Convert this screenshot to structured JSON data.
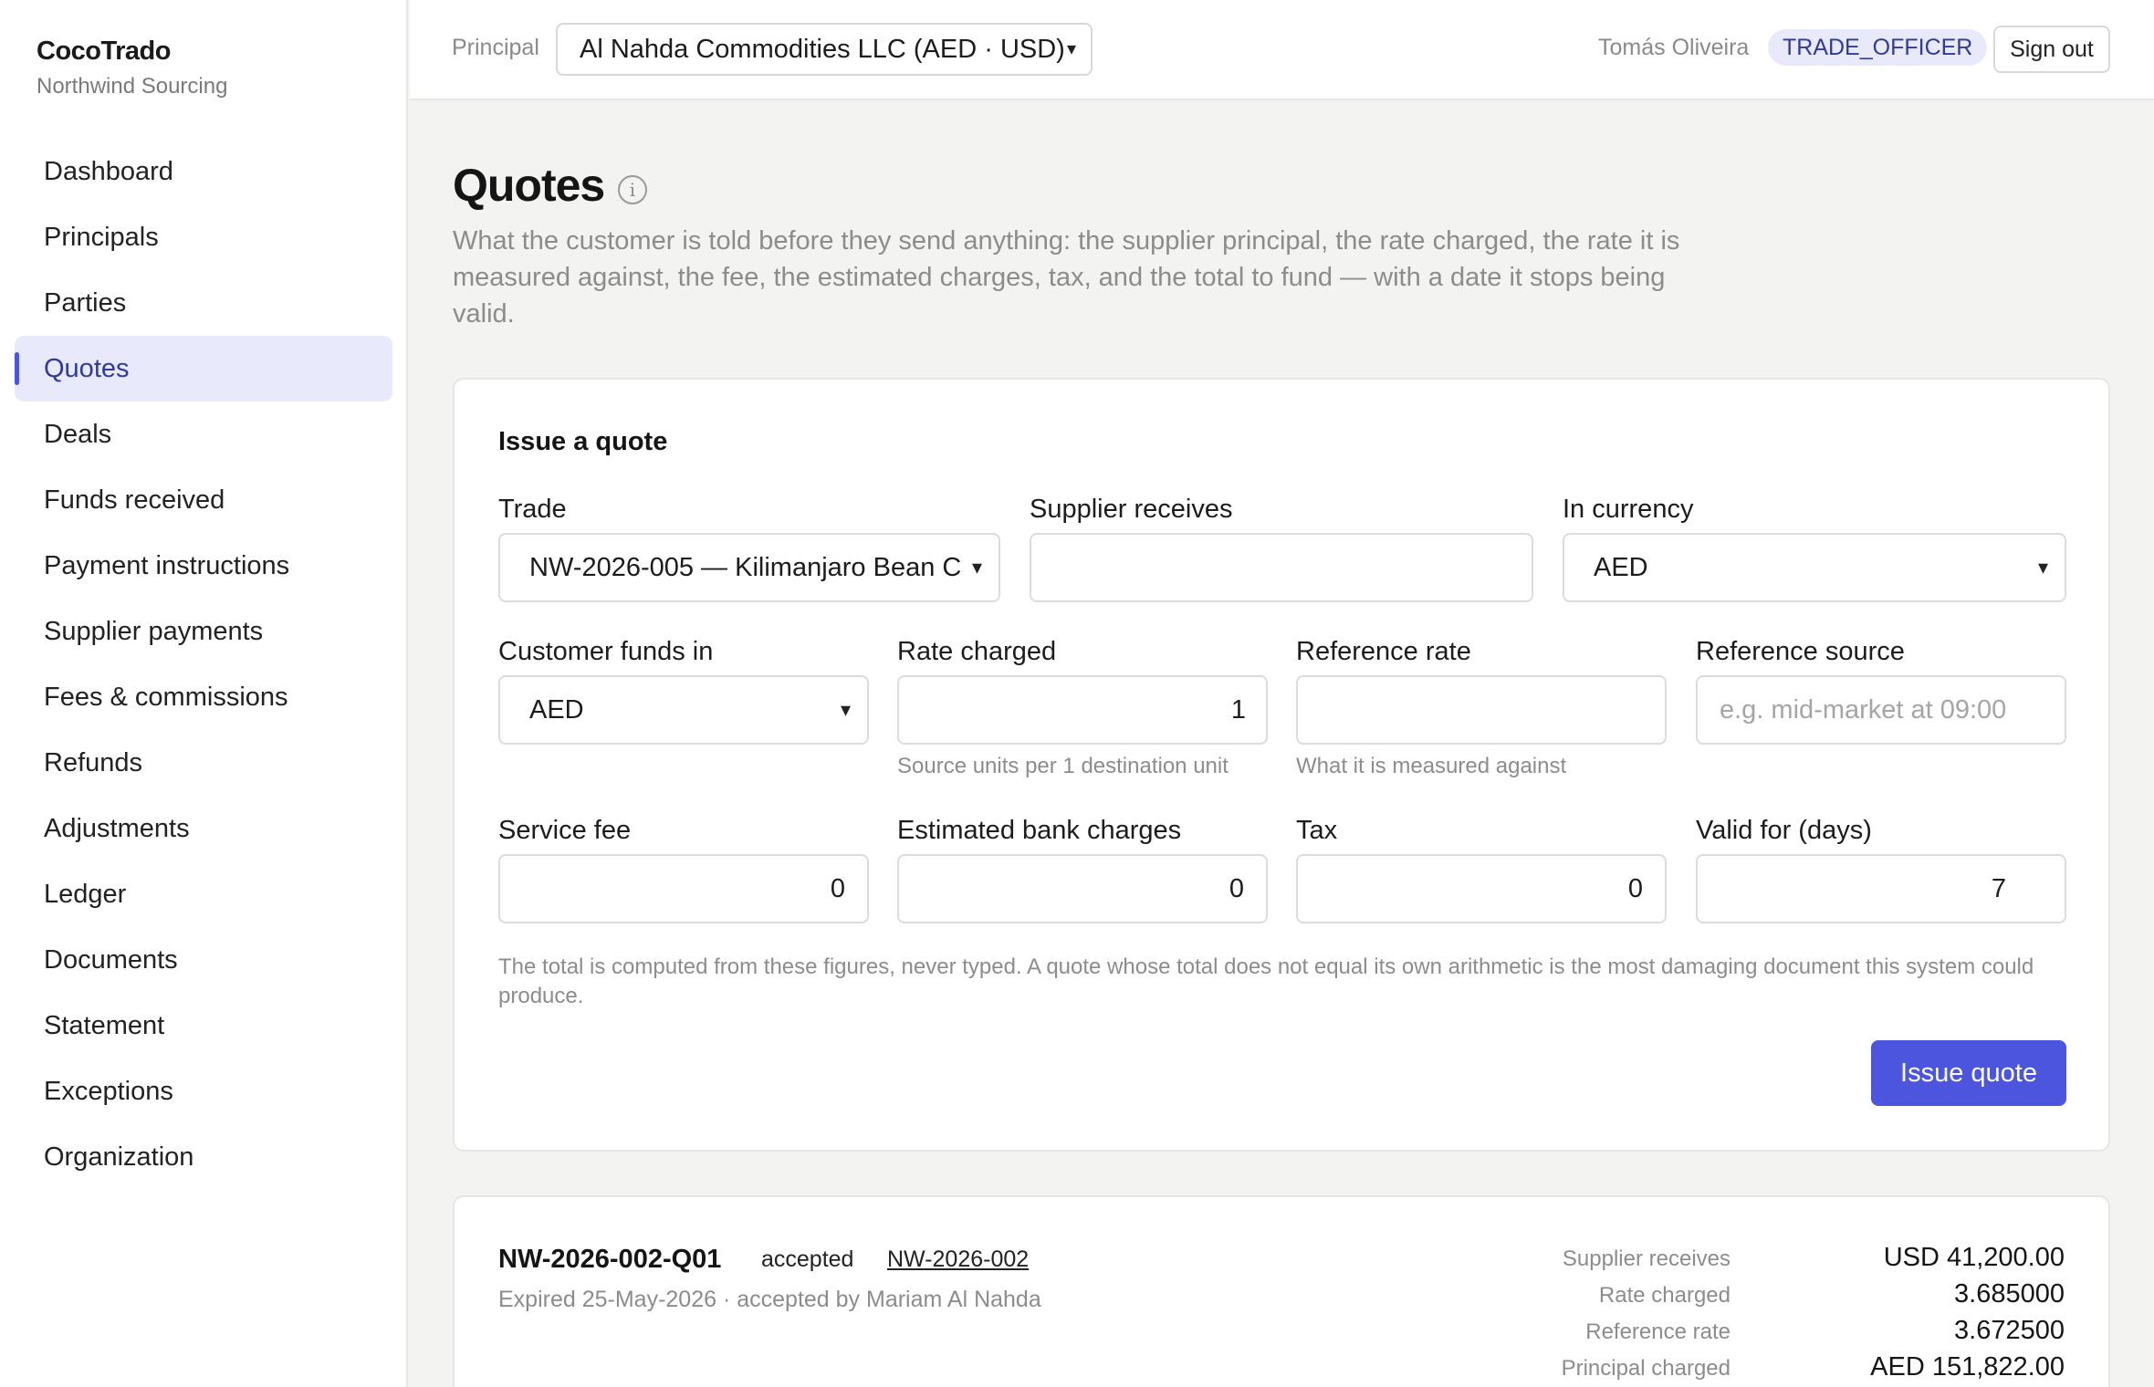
{
  "brand": {
    "name": "CocoTrado",
    "org": "Northwind Sourcing"
  },
  "nav": {
    "active": "Quotes",
    "items": [
      "Dashboard",
      "Principals",
      "Parties",
      "Quotes",
      "Deals",
      "Funds received",
      "Payment instructions",
      "Supplier payments",
      "Fees & commissions",
      "Refunds",
      "Adjustments",
      "Ledger",
      "Documents",
      "Statement",
      "Exceptions",
      "Organization"
    ]
  },
  "topbar": {
    "principal_label": "Principal",
    "principal_value": "Al Nahda Commodities LLC (AED · USD)",
    "user_name": "Tomás Oliveira",
    "role": "TRADE_OFFICER",
    "signout_label": "Sign out"
  },
  "page": {
    "title": "Quotes",
    "info_icon": "info-icon",
    "description": "What the customer is told before they send anything: the supplier principal, the rate charged, the rate it is measured against, the fee, the estimated charges, tax, and the total to fund — with a date it stops being valid."
  },
  "form": {
    "title": "Issue a quote",
    "trade": {
      "label": "Trade",
      "value": "NW-2026-005 — Kilimanjaro Bean C"
    },
    "supplier_receives": {
      "label": "Supplier receives",
      "value": ""
    },
    "in_currency": {
      "label": "In currency",
      "value": "AED"
    },
    "customer_funds_in": {
      "label": "Customer funds in",
      "value": "AED"
    },
    "rate_charged": {
      "label": "Rate charged",
      "value": "1",
      "hint": "Source units per 1 destination unit"
    },
    "reference_rate": {
      "label": "Reference rate",
      "value": "",
      "hint": "What it is measured against"
    },
    "reference_source": {
      "label": "Reference source",
      "placeholder": "e.g. mid-market at 09:00"
    },
    "service_fee": {
      "label": "Service fee",
      "value": "0"
    },
    "bank_charges": {
      "label": "Estimated bank charges",
      "value": "0"
    },
    "tax": {
      "label": "Tax",
      "value": "0"
    },
    "valid_for": {
      "label": "Valid for (days)",
      "value": "7"
    },
    "note": "The total is computed from these figures, never typed. A quote whose total does not equal its own arithmetic is the most damaging document this system could produce.",
    "submit_label": "Issue quote"
  },
  "quotes": [
    {
      "id": "NW-2026-002-Q01",
      "status": "accepted",
      "trade_link": "NW-2026-002",
      "meta": "Expired 25-May-2026 · accepted by Mariam Al Nahda",
      "rows": [
        {
          "label": "Supplier receives",
          "value": "USD 41,200.00"
        },
        {
          "label": "Rate charged",
          "value": "3.685000"
        },
        {
          "label": "Reference rate",
          "value": "3.672500"
        },
        {
          "label": "Principal charged",
          "value": "AED 151,822.00"
        }
      ]
    }
  ]
}
